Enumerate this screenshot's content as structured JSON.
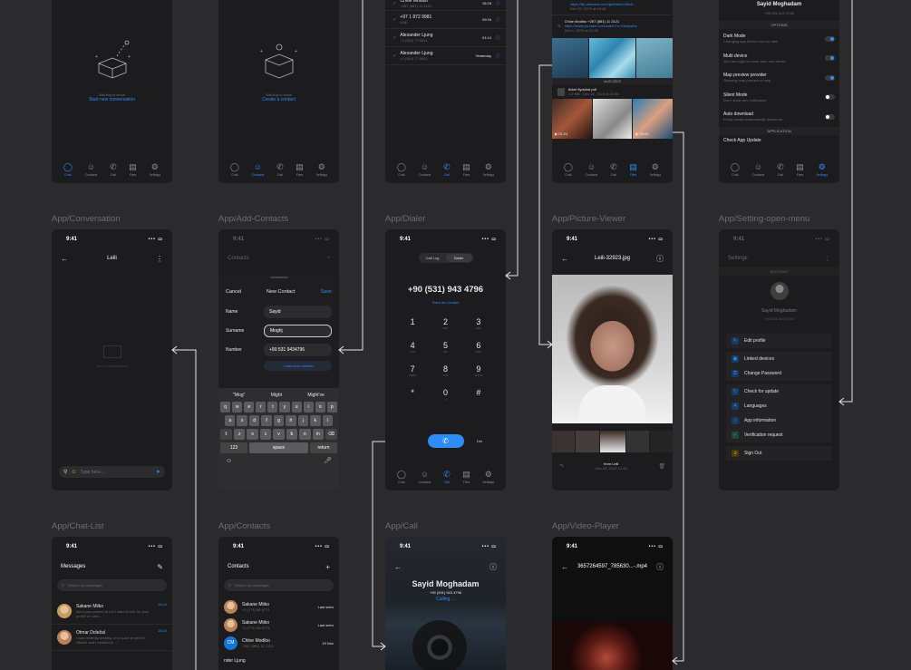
{
  "sections": {
    "conversation": "App/Conversation",
    "add_contacts": "App/Add-Contacts",
    "dialer": "App/Dialer",
    "picture_viewer": "App/Picture-Viewer",
    "setting_menu": "App/Setting-open-menu",
    "chat_list": "App/Chat-List",
    "contacts": "App/Contacts",
    "call": "App/Call",
    "video_player": "App/Video-Player"
  },
  "status_time": "9:41",
  "tabs": [
    "Chat",
    "Contacts",
    "Call",
    "Files",
    "Settings"
  ],
  "empty_chat": {
    "title": "Nothing to show",
    "action": "Start new conversation"
  },
  "empty_contacts": {
    "title": "Nothing to show",
    "action": "Create a contact"
  },
  "call_history": [
    {
      "name": "Chloe Modibo",
      "phone": "+267 (881) 11 2121",
      "time": "16:18"
    },
    {
      "name": "+97 1 872 9981",
      "phone": "UAE",
      "time": "09:16"
    },
    {
      "name": "Alexander Ljung",
      "phone": "+1 (551) 77 8811",
      "time": "01:14"
    },
    {
      "name": "Alexander Ljung",
      "phone": "+1 (551) 77 8811",
      "time": "Yesterday"
    }
  ],
  "files": {
    "link1": "https://ftp.domaine.com/grabtorfo.ti/bull...",
    "link1_date": "Dec 20, 2023 at 18:46",
    "chloe": "Chloe Modibo +267 (881) 11 2121",
    "link2": "https://www.youtube.com/watch?v=Vil4psdha",
    "link2_date": "Dec 1, 2023 at 12:25",
    "month": "AUG 2023",
    "pdf_name": "ticket flydubai.pdf",
    "pdf_meta": "1.2 MB · Dec 20, 2023 at 18:46",
    "dur1": "01:24",
    "dur2": "06:48"
  },
  "settings_top": {
    "name": "Sayid Moghadam",
    "phone": "+90 531 943 4796",
    "options_header": "OPTIONS",
    "items": [
      {
        "label": "Dark Mode",
        "desc": "Changing app theme color to dark",
        "on": true
      },
      {
        "label": "Multi device",
        "desc": "You can login on more than one device",
        "on": true
      },
      {
        "label": "Map preview provider",
        "desc": "Showing map preview in msg",
        "on": true
      },
      {
        "label": "Silent Mode",
        "desc": "Don't show any notification",
        "on": false
      },
      {
        "label": "Auto download",
        "desc": "Every media automatically download",
        "on": false
      }
    ],
    "app_header": "APPLICATION",
    "check_update": "Check App Update"
  },
  "conversation": {
    "title": "Leili",
    "empty": "Start a conversation",
    "placeholder": "Type here..."
  },
  "add_contact": {
    "bg_title": "Contacts",
    "cancel": "Cancel",
    "title": "New Contact",
    "save": "Save",
    "name_label": "Name",
    "name_value": "Sayid",
    "surname_label": "Surname",
    "surname_value": "Moghj",
    "number_label": "Number",
    "number_value": "+90 531 9434796",
    "add_more": "+ add more number",
    "suggestions": [
      "\"Mog\"",
      "Might",
      "Might've"
    ],
    "row1": [
      "q",
      "w",
      "e",
      "r",
      "t",
      "y",
      "u",
      "i",
      "o",
      "p"
    ],
    "row2": [
      "a",
      "s",
      "d",
      "f",
      "g",
      "h",
      "j",
      "k",
      "l"
    ],
    "row3": [
      "z",
      "x",
      "c",
      "v",
      "b",
      "n",
      "m"
    ],
    "k123": "123",
    "space": "space",
    "return": "return"
  },
  "dialer": {
    "seg_log": "Call Log",
    "seg_dialer": "Dialer",
    "number": "+90 (531) 943 4796",
    "save": "Save as Contact",
    "keys": [
      {
        "d": "1",
        "l": ""
      },
      {
        "d": "2",
        "l": "ABC"
      },
      {
        "d": "3",
        "l": "DEF"
      },
      {
        "d": "4",
        "l": "GHI"
      },
      {
        "d": "5",
        "l": "JKL"
      },
      {
        "d": "6",
        "l": "MNO"
      },
      {
        "d": "7",
        "l": "PQRS"
      },
      {
        "d": "8",
        "l": "TUV"
      },
      {
        "d": "9",
        "l": "WXYZ"
      },
      {
        "d": "*",
        "l": ""
      },
      {
        "d": "0",
        "l": "+"
      },
      {
        "d": "#",
        "l": ""
      }
    ],
    "del": "Del"
  },
  "picture": {
    "title": "Leili-32923.jpg",
    "from": "from Leili",
    "date": "Dec 23, 2023 12:29"
  },
  "setting_menu": {
    "bg_title": "Settings",
    "account": "ACCOUNT",
    "name": "Sayid Moghadam",
    "phone": "+90 531 943 4796",
    "items1": [
      "Edit profile"
    ],
    "items2": [
      "Linked devices",
      "Change Password"
    ],
    "items3": [
      "Check for update",
      "Languages",
      "App information",
      "Verification request"
    ],
    "signout": "Sign Out"
  },
  "chat_list": {
    "title": "Messages",
    "search": "Search for messages",
    "items": [
      {
        "name": "Sakane Miiko",
        "msg": "send your picture to me I want to use for your profile on web...",
        "time": "16:10"
      },
      {
        "name": "Otmar Doležal",
        "msg": "I was recently working on a quick project in Sketch and I needed to ...",
        "time": "16:10"
      }
    ]
  },
  "contacts_list": {
    "title": "Contacts",
    "search": "Search for messages",
    "items": [
      {
        "name": "Sakane Miiko",
        "phone": "+1 (771) 56 5771",
        "status": "Last seen",
        "init": ""
      },
      {
        "name": "Sakane Miiko",
        "phone": "+1 (771) 56 5771",
        "status": "Last seen",
        "init": ""
      },
      {
        "name": "Chloe Modibo",
        "phone": "+267 (881) 11 2121",
        "status": "19 Nov",
        "init": "CM"
      },
      {
        "name": "nder Ljung",
        "phone": "",
        "status": "",
        "init": ""
      }
    ]
  },
  "call": {
    "name": "Sayid Moghadam",
    "phone": "+90 (531) 943 4796",
    "status": "Calling ..."
  },
  "video": {
    "title": "3657264597_785630...-.mp4"
  }
}
